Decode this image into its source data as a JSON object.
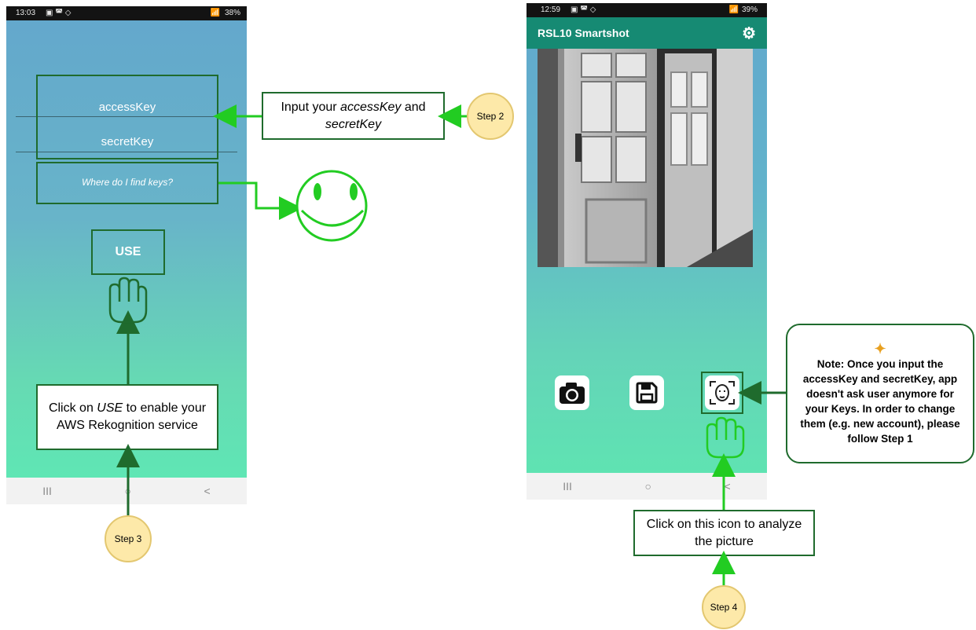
{
  "left_phone": {
    "status": {
      "time": "13:03",
      "battery": "38%"
    },
    "fields": {
      "access_key": "accessKey",
      "secret_key": "secretKey"
    },
    "find_keys_link": "Where do I find keys?",
    "use_button": "USE",
    "nav": {
      "recent": "III",
      "home": "○",
      "back": "<"
    }
  },
  "right_phone": {
    "status": {
      "time": "12:59",
      "battery": "39%"
    },
    "app_title": "RSL10 Smartshot",
    "nav": {
      "recent": "III",
      "home": "○",
      "back": "<"
    }
  },
  "annotations": {
    "step2_text_a": "Input your ",
    "step2_text_b": "accessKey",
    "step2_text_c": " and ",
    "step2_text_d": "secretKey",
    "step3_text_a": "Click on ",
    "step3_text_b": "USE",
    "step3_text_c": " to enable your AWS Rekognition service",
    "step4_text": "Click on this icon to analyze the picture",
    "note_text": "Note: Once you input the accessKey and secretKey, app doesn't ask user anymore for your Keys. In order to change them (e.g. new account), please follow Step 1",
    "step2_label": "Step 2",
    "step3_label": "Step 3",
    "step4_label": "Step 4"
  },
  "colors": {
    "annotation_green": "#1f6b2d",
    "arrow_green": "#22cc22",
    "step_fill": "#fde9a9"
  }
}
